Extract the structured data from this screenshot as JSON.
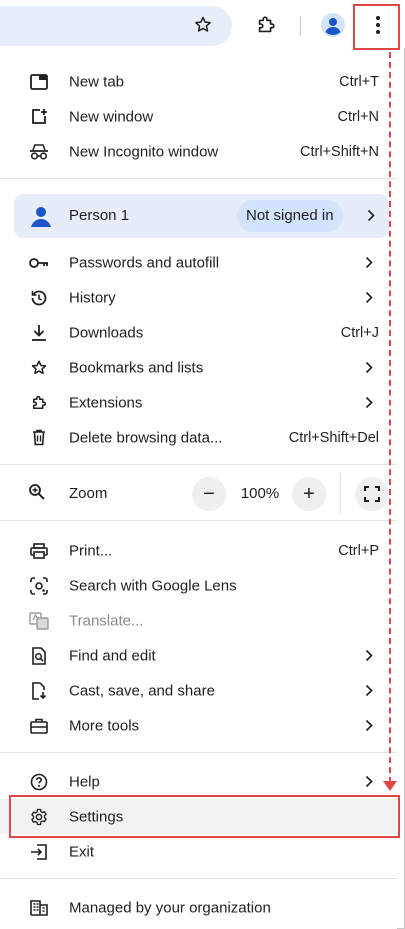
{
  "menu": {
    "new_tab": {
      "label": "New tab",
      "shortcut": "Ctrl+T"
    },
    "new_window": {
      "label": "New window",
      "shortcut": "Ctrl+N"
    },
    "incognito": {
      "label": "New Incognito window",
      "shortcut": "Ctrl+Shift+N"
    },
    "profile": {
      "name": "Person 1",
      "status": "Not signed in"
    },
    "passwords": {
      "label": "Passwords and autofill"
    },
    "history": {
      "label": "History"
    },
    "downloads": {
      "label": "Downloads",
      "shortcut": "Ctrl+J"
    },
    "bookmarks": {
      "label": "Bookmarks and lists"
    },
    "extensions": {
      "label": "Extensions"
    },
    "delete_data": {
      "label": "Delete browsing data...",
      "shortcut": "Ctrl+Shift+Del"
    },
    "zoom": {
      "label": "Zoom",
      "value": "100%",
      "minus": "−",
      "plus": "+"
    },
    "print": {
      "label": "Print...",
      "shortcut": "Ctrl+P"
    },
    "lens": {
      "label": "Search with Google Lens"
    },
    "translate": {
      "label": "Translate..."
    },
    "find": {
      "label": "Find and edit"
    },
    "cast": {
      "label": "Cast, save, and share"
    },
    "more_tools": {
      "label": "More tools"
    },
    "help": {
      "label": "Help"
    },
    "settings": {
      "label": "Settings"
    },
    "exit": {
      "label": "Exit"
    },
    "managed": {
      "label": "Managed by your organization"
    }
  },
  "colors": {
    "accent": "#1a73e8",
    "highlight": "#e04848",
    "profile_bg": "#e6edf9"
  }
}
